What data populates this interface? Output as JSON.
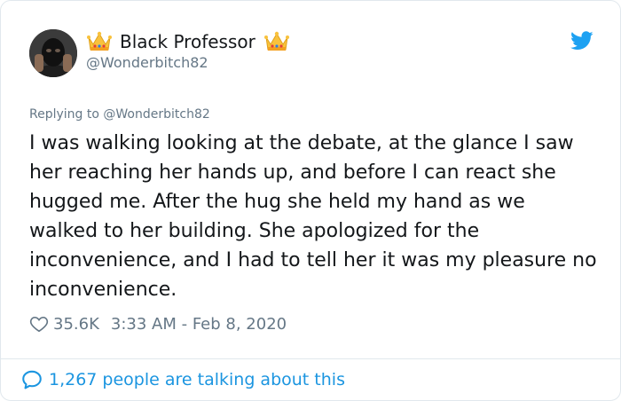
{
  "user": {
    "display_name": "Black Professor",
    "handle": "@Wonderbitch82",
    "avatar": "masked-person-avatar",
    "name_emoji": "crown-emoji"
  },
  "reply": {
    "prefix": "Replying to",
    "mention": "@Wonderbitch82"
  },
  "tweet": {
    "text": "I was walking looking at the debate, at the glance I saw her reaching her hands up, and before I can react she hugged me. After the hug she held my hand as we walked to her building. She apologized for the inconvenience, and I had to tell her it was my pleasure no inconvenience."
  },
  "meta": {
    "likes": "35.6K",
    "timestamp": "3:33 AM - Feb 8, 2020"
  },
  "footer": {
    "talking_label": "1,267 people are talking about this"
  },
  "colors": {
    "twitter_blue": "#1da1f2",
    "link_blue": "#1b95e0",
    "muted_text": "#657786",
    "border": "#e1e8ed"
  },
  "icons": {
    "brand": "twitter-bird-icon",
    "like": "heart-icon",
    "conversation": "speech-bubble-icon"
  }
}
